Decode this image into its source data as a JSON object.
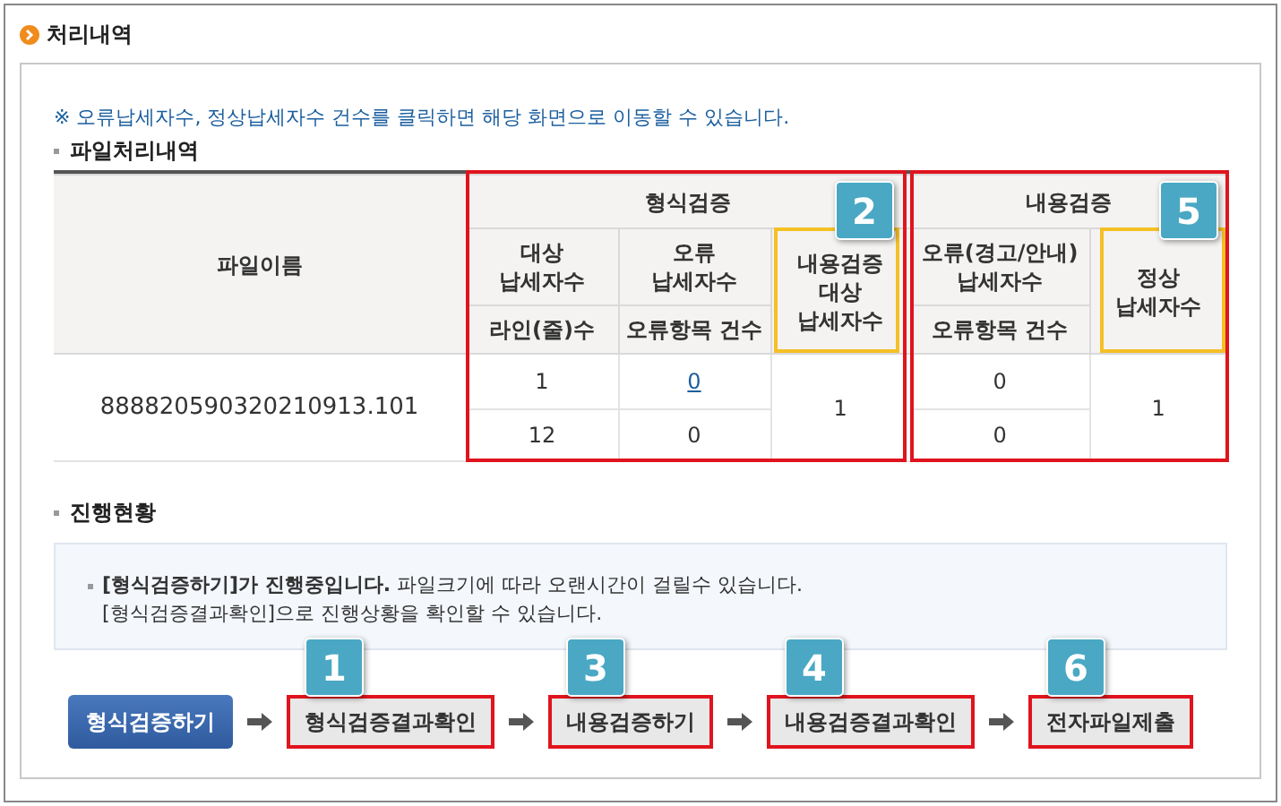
{
  "section_title": "처리내역",
  "notice": "※ 오류납세자수, 정상납세자수 건수를 클릭하면 해당 화면으로 이동할 수 있습니다.",
  "file_section_title": "파일처리내역",
  "table": {
    "file_name_header": "파일이름",
    "groups": [
      {
        "title": "형식검증",
        "highlighted": true,
        "badge": "2",
        "columns": [
          {
            "header": "대상\n납세자수",
            "subheader": "라인(줄)수"
          },
          {
            "header": "오류\n납세자수",
            "subheader": "오류항목 건수"
          }
        ],
        "merged_header": "내용검증\n대상\n납세자수",
        "merged_highlighted": true
      },
      {
        "title": "내용검증",
        "highlighted": true,
        "badge": "5",
        "columns": [
          {
            "header": "오류(경고/안내)\n납세자수",
            "subheader": "오류항목 건수"
          }
        ],
        "merged_header": "정상\n납세자수",
        "merged_highlighted": true
      }
    ],
    "file_name": "888820590320210913.101",
    "rows": [
      {
        "cells": [
          {
            "text": "1",
            "link": false
          },
          {
            "text": "0",
            "link": true
          }
        ],
        "merged": "1",
        "content_cells": [
          {
            "text": "0",
            "link": false
          }
        ],
        "content_merged": "1"
      },
      {
        "cells": [
          {
            "text": "12",
            "link": false
          },
          {
            "text": "0",
            "link": false
          }
        ],
        "content_cells": [
          {
            "text": "0",
            "link": false
          }
        ]
      }
    ]
  },
  "progress_title": "진행현황",
  "progress_message": "**[형식검증하기]가 진행중입니다.** 파일크기에 따라 오랜시간이 걸릴수 있습니다.",
  "progress_hint": "[형식검증결과확인]으로 진행상황을 확인할 수 있습니다.",
  "steps": [
    {
      "label": "형식검증하기",
      "kind": "primary"
    },
    {
      "label": "형식검증결과확인",
      "kind": "step",
      "highlighted": true,
      "badge": "1"
    },
    {
      "label": "내용검증하기",
      "kind": "step",
      "highlighted": true,
      "badge": "3"
    },
    {
      "label": "내용검증결과확인",
      "kind": "step",
      "highlighted": true,
      "badge": "4"
    },
    {
      "label": "전자파일제출",
      "kind": "step",
      "highlighted": true,
      "badge": "6"
    }
  ]
}
